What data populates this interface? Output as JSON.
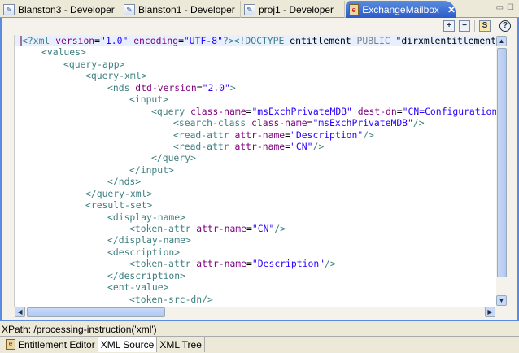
{
  "tabs": [
    {
      "label": "Blanston3 - Developer",
      "active": false
    },
    {
      "label": "Blanston1 - Developer",
      "active": false
    },
    {
      "label": "proj1 - Developer",
      "active": false
    },
    {
      "label": "ExchangeMailbox",
      "active": true
    }
  ],
  "toolbar": {
    "expand": "+",
    "collapse": "−",
    "schema": "S",
    "help": "?"
  },
  "code_lines": [
    {
      "i": 0,
      "s": [
        [
          "p",
          "<?xml "
        ],
        [
          "a",
          "version"
        ],
        [
          "d",
          "="
        ],
        [
          "v",
          "\"1.0\""
        ],
        [
          "d",
          " "
        ],
        [
          "a",
          "encoding"
        ],
        [
          "d",
          "="
        ],
        [
          "v",
          "\"UTF-8\""
        ],
        [
          "p",
          "?>"
        ],
        [
          "t",
          "<!DOCTYPE "
        ],
        [
          "d",
          "entitlement "
        ],
        [
          "k",
          "PUBLIC "
        ],
        [
          "d",
          "\"dirxmlentitlements\""
        ]
      ]
    },
    {
      "i": 1,
      "s": [
        [
          "t",
          "<values>"
        ]
      ]
    },
    {
      "i": 2,
      "s": [
        [
          "t",
          "<query-app>"
        ]
      ]
    },
    {
      "i": 3,
      "s": [
        [
          "t",
          "<query-xml>"
        ]
      ]
    },
    {
      "i": 4,
      "s": [
        [
          "t",
          "<nds "
        ],
        [
          "a",
          "dtd-version"
        ],
        [
          "d",
          "="
        ],
        [
          "v",
          "\"2.0\""
        ],
        [
          "t",
          ">"
        ]
      ]
    },
    {
      "i": 5,
      "s": [
        [
          "t",
          "<input>"
        ]
      ]
    },
    {
      "i": 6,
      "s": [
        [
          "t",
          "<query "
        ],
        [
          "a",
          "class-name"
        ],
        [
          "d",
          "="
        ],
        [
          "v",
          "\"msExchPrivateMDB\""
        ],
        [
          "d",
          " "
        ],
        [
          "a",
          "dest-dn"
        ],
        [
          "d",
          "="
        ],
        [
          "v",
          "\"CN=Configuration,"
        ]
      ]
    },
    {
      "i": 7,
      "s": [
        [
          "t",
          "<search-class "
        ],
        [
          "a",
          "class-name"
        ],
        [
          "d",
          "="
        ],
        [
          "v",
          "\"msExchPrivateMDB\""
        ],
        [
          "t",
          "/>"
        ]
      ]
    },
    {
      "i": 7,
      "s": [
        [
          "t",
          "<read-attr "
        ],
        [
          "a",
          "attr-name"
        ],
        [
          "d",
          "="
        ],
        [
          "v",
          "\"Description\""
        ],
        [
          "t",
          "/>"
        ]
      ]
    },
    {
      "i": 7,
      "s": [
        [
          "t",
          "<read-attr "
        ],
        [
          "a",
          "attr-name"
        ],
        [
          "d",
          "="
        ],
        [
          "v",
          "\"CN\""
        ],
        [
          "t",
          "/>"
        ]
      ]
    },
    {
      "i": 6,
      "s": [
        [
          "t",
          "</query>"
        ]
      ]
    },
    {
      "i": 5,
      "s": [
        [
          "t",
          "</input>"
        ]
      ]
    },
    {
      "i": 4,
      "s": [
        [
          "t",
          "</nds>"
        ]
      ]
    },
    {
      "i": 3,
      "s": [
        [
          "t",
          "</query-xml>"
        ]
      ]
    },
    {
      "i": 3,
      "s": [
        [
          "t",
          "<result-set>"
        ]
      ]
    },
    {
      "i": 4,
      "s": [
        [
          "t",
          "<display-name>"
        ]
      ]
    },
    {
      "i": 5,
      "s": [
        [
          "t",
          "<token-attr "
        ],
        [
          "a",
          "attr-name"
        ],
        [
          "d",
          "="
        ],
        [
          "v",
          "\"CN\""
        ],
        [
          "t",
          "/>"
        ]
      ]
    },
    {
      "i": 4,
      "s": [
        [
          "t",
          "</display-name>"
        ]
      ]
    },
    {
      "i": 4,
      "s": [
        [
          "t",
          "<description>"
        ]
      ]
    },
    {
      "i": 5,
      "s": [
        [
          "t",
          "<token-attr "
        ],
        [
          "a",
          "attr-name"
        ],
        [
          "d",
          "="
        ],
        [
          "v",
          "\"Description\""
        ],
        [
          "t",
          "/>"
        ]
      ]
    },
    {
      "i": 4,
      "s": [
        [
          "t",
          "</description>"
        ]
      ]
    },
    {
      "i": 4,
      "s": [
        [
          "t",
          "<ent-value>"
        ]
      ]
    },
    {
      "i": 5,
      "s": [
        [
          "t",
          "<token-src-dn/>"
        ]
      ]
    }
  ],
  "xpath": "XPath:  /processing-instruction('xml')",
  "bottom_tabs": [
    {
      "label": "Entitlement Editor",
      "active": false
    },
    {
      "label": "XML Source",
      "active": true
    },
    {
      "label": "XML Tree",
      "active": false
    }
  ]
}
